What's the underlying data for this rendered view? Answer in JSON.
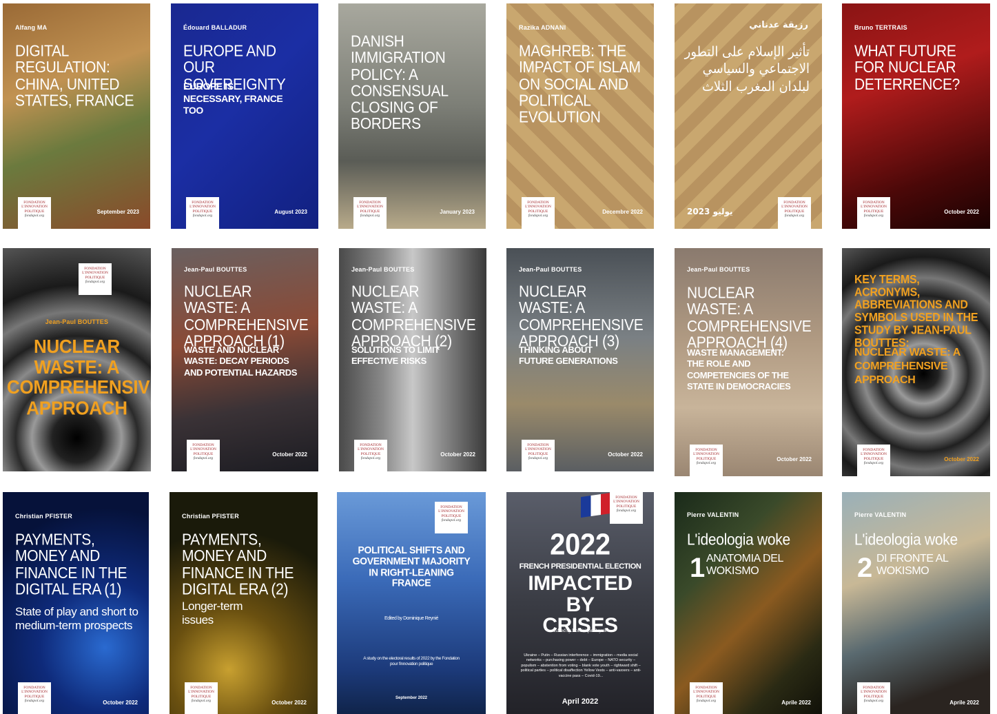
{
  "logo": {
    "line1": "FONDATION",
    "line2": "L'INNOVATION",
    "line3": "POLITIQUE",
    "line4": "fondapol.org"
  },
  "covers": [
    {
      "author": "Alfang MA",
      "title": "Digital regulation: China, United States, France",
      "subtitle": "",
      "date": "September 2023",
      "colors": [
        "#8a5a2a",
        "#c18a4a",
        "#4f6b3a"
      ]
    },
    {
      "author": "Édouard BALLADUR",
      "title": "Europe and our sovereignty",
      "subtitle": "Europe is necessary, France too",
      "date": "August 2023",
      "colors": [
        "#15227a",
        "#1d2f9a",
        "#0f1a66"
      ]
    },
    {
      "author": "",
      "title": "Danish immigration policy: a consensual closing of borders",
      "subtitle": "",
      "date": "January 2023",
      "colors": [
        "#8a8c86",
        "#5f625b",
        "#c2b59a"
      ]
    },
    {
      "author": "Razika ADNANI",
      "title": "Maghreb: the impact of Islam on social and political evolution",
      "subtitle": "",
      "date": "Decembre 2022",
      "colors": [
        "#b08a56",
        "#d2b27d",
        "#8a5f34"
      ]
    },
    {
      "author": "رزيقة عدناني",
      "title": "تأثير الإسلام على التطور الاجتماعي والسياسي لبلدان المغرب الثلاث",
      "subtitle": "",
      "date": "يوليو 2023",
      "colors": [
        "#b08a56",
        "#d2b27d",
        "#8a5f34"
      ]
    },
    {
      "author": "Bruno TERTRAIS",
      "title": "What future for nuclear deterrence?",
      "subtitle": "",
      "date": "October 2022",
      "colors": [
        "#6a0c0c",
        "#a0181a",
        "#2a0606"
      ]
    },
    {
      "author": "Jean-Paul BOUTTES",
      "title": "Nuclear waste: a comprehensive approach",
      "subtitle": "",
      "date": "",
      "colors": [
        "#333333",
        "#777777",
        "#111111"
      ]
    },
    {
      "author": "Jean-Paul BOUTTES",
      "title": "Nuclear waste: a comprehensive approach (1)",
      "subtitle": "Waste and nuclear waste: decay periods and potential hazards",
      "date": "October 2022",
      "colors": [
        "#5a4a46",
        "#8a3a2a",
        "#2a2a30"
      ]
    },
    {
      "author": "Jean-Paul BOUTTES",
      "title": "Nuclear waste: a comprehensive approach (2)",
      "subtitle": "Solutions to limit effective risks",
      "date": "October 2022",
      "colors": [
        "#7a7a7a",
        "#b0b0b0",
        "#3a3a3a"
      ]
    },
    {
      "author": "Jean-Paul BOUTTES",
      "title": "Nuclear waste: a comprehensive approach (3)",
      "subtitle": "Thinking about future generations",
      "date": "October 2022",
      "colors": [
        "#5e646a",
        "#8a8e90",
        "#3a3e40"
      ]
    },
    {
      "author": "Jean-Paul BOUTTES",
      "title": "Nuclear waste: a comprehensive approach (4)",
      "subtitle": "Waste management: the role and competencies of the state in democracies",
      "date": "October 2022",
      "colors": [
        "#9a8a7a",
        "#c0aa8e",
        "#6a5a4a"
      ]
    },
    {
      "author": "",
      "title": "Key terms, acronyms, abbreviations and symbols used in the study by Jean-Paul Bouttes:",
      "subtitle": "Nuclear waste: a comprehensive approach",
      "date": "October 2022",
      "colors": [
        "#333333",
        "#777777",
        "#111111"
      ]
    },
    {
      "author": "Christian PFISTER",
      "title": "Payments, money and finance in the digital era (1)",
      "subtitle": "State of play and short to medium-term prospects",
      "date": "October 2022",
      "colors": [
        "#0a1a4a",
        "#123a8a",
        "#050e2a"
      ]
    },
    {
      "author": "Christian PFISTER",
      "title": "Payments, money and finance in the digital era (2)",
      "subtitle": "Longer-term issues",
      "date": "October 2022",
      "colors": [
        "#2a2a10",
        "#8a6a10",
        "#0a0a0a"
      ]
    },
    {
      "author": "",
      "title": "Political shifts and government majority in right-leaning France",
      "subtitle": "Edited by Dominique Reynié",
      "date": "September 2022",
      "note": "A study on the electoral results of 2022 by the Fondation pour l'innovation politique",
      "colors": [
        "#2a5aa8",
        "#5a8ad0",
        "#102a5a"
      ]
    },
    {
      "author": "",
      "title": "2022",
      "subtitle": "French presidential election",
      "big": "Impacted by crises",
      "editor": "Edited by Dominique Reynié",
      "keywords": "Ukraine – Putin – Russian interference – immigration – media social networks – purchasing power – debt – Europe – NATO security – populism – abstention from voting – blank vote youth – rightward shift – political parties – political disaffection Yellow Vests – anti-vaxxers – anti-vaccine pass – Covid-19...",
      "date": "April 2022",
      "colors": [
        "#3a3a40",
        "#5a5a62",
        "#1e1e22"
      ]
    },
    {
      "author": "Pierre VALENTIN",
      "title": "L'ideologia woke",
      "number": "1",
      "subtitle": "Anatomia del wokismo",
      "date": "Aprile 2022",
      "colors": [
        "#2a3a2a",
        "#6a4a20",
        "#1a1a10"
      ]
    },
    {
      "author": "Pierre VALENTIN",
      "title": "L'ideologia woke",
      "number": "2",
      "subtitle": "Di fronte al wokismo",
      "date": "Aprile 2022",
      "colors": [
        "#6a8a9a",
        "#c0b090",
        "#3a4a5a"
      ]
    }
  ]
}
